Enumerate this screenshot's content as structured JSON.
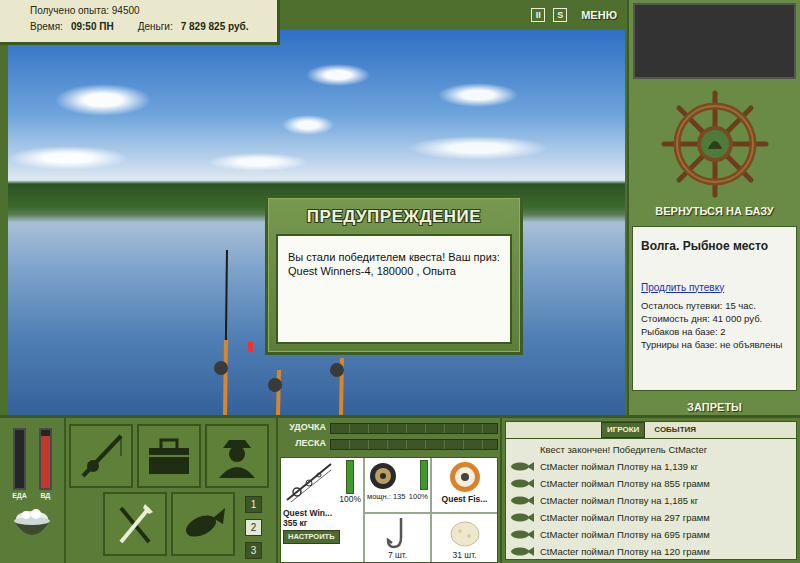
{
  "header": {
    "experience_label": "Получено опыта:",
    "experience": "94500",
    "time_label": "Время:",
    "time": "09:50 ПН",
    "money_label": "Деньги:",
    "money": "7 829 825 руб."
  },
  "toolbar": {
    "buttons": [
      {
        "label": "II"
      },
      {
        "label": "S"
      }
    ],
    "menu": "МЕНЮ"
  },
  "dialog": {
    "title": "ПРЕДУПРЕЖДЕНИЕ",
    "message": "Вы стали победителем квеста! Ваш приз: Quest Winners-4, 180000 , Опыта"
  },
  "sidebar": {
    "return_button": "ВЕРНУТЬСЯ НА БАЗУ",
    "location": "Волга. Рыбное место",
    "extend_link": "Продлить путевку",
    "info": [
      "Осталось путевки: 15 час.",
      "Стоимость дня: 41 000 руб.",
      "Рыбаков на базе: 2",
      "Турниры на базе: не объявлены"
    ],
    "bans_button": "ЗАПРЕТЫ"
  },
  "meters": [
    {
      "label": "ЕДА",
      "level": 0,
      "color": "#262626"
    },
    {
      "label": "ВД",
      "level": 0.9,
      "color": "#c0392b"
    }
  ],
  "pages": [
    {
      "label": "1",
      "selected": false
    },
    {
      "label": "2",
      "selected": true
    },
    {
      "label": "3",
      "selected": false
    }
  ],
  "tackle": {
    "rod_label": "УДОЧКА",
    "rod_level": 0,
    "line_label": "ЛЕСКА",
    "line_level": 0
  },
  "rod": {
    "name": "Quest Win...",
    "weight": "355 кг",
    "condition": "100%",
    "level": 1
  },
  "reel": {
    "power": "мощн.: 135",
    "condition": "100%",
    "level": 1
  },
  "line": {
    "name": "Quest Fis..."
  },
  "hook": {
    "count": "7 шт."
  },
  "bait": {
    "count": "31 шт."
  },
  "setup_button": "НАСТРОИТЬ",
  "events": {
    "tabs": [
      {
        "label": "ИГРОКИ",
        "selected": true
      },
      {
        "label": "СОБЫТИЯ",
        "selected": false
      }
    ],
    "items": [
      {
        "kind": "notice",
        "text": "Квест закончен! Победитель CtMacter"
      },
      {
        "kind": "catch",
        "text": "CtMacter поймал Плотву на 1,139 кг"
      },
      {
        "kind": "catch",
        "text": "CtMacter поймал Плотву на 855 грамм"
      },
      {
        "kind": "catch",
        "text": "CtMacter поймал Плотву на 1,185 кг"
      },
      {
        "kind": "catch",
        "text": "CtMacter поймал Плотву на 297 грамм"
      },
      {
        "kind": "catch",
        "text": "CtMacter поймал Плотву на 695 грамм"
      },
      {
        "kind": "catch",
        "text": "CtMacter поймал Плотву на 120 грамм"
      }
    ]
  }
}
